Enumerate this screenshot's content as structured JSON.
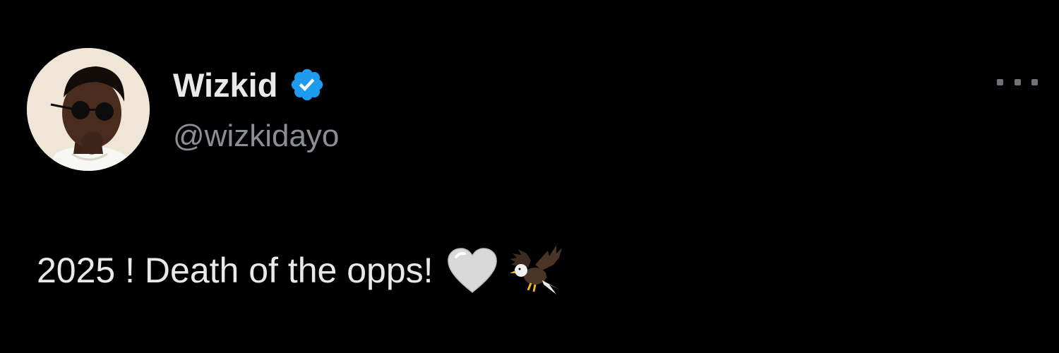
{
  "tweet": {
    "display_name": "Wizkid",
    "handle": "@wizkidayo",
    "text": "2025 ! Death of the opps!",
    "emojis": [
      "white-heart-icon",
      "eagle-icon"
    ],
    "verified": true
  },
  "colors": {
    "background": "#000000",
    "text_primary": "#e7e9ea",
    "text_secondary": "#8b8f94",
    "verified_badge": "#1d9bf0"
  },
  "icons": {
    "more": "more-options-icon",
    "verified": "verified-badge-icon"
  }
}
